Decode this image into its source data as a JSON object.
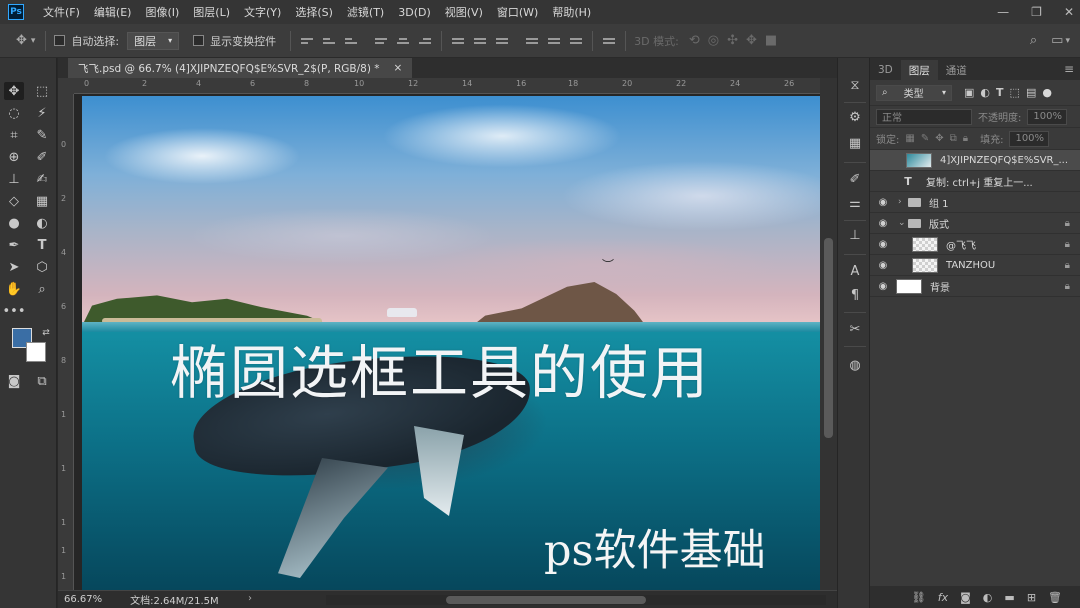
{
  "app": {
    "logo": "Ps"
  },
  "menu": [
    "文件(F)",
    "编辑(E)",
    "图像(I)",
    "图层(L)",
    "文字(Y)",
    "选择(S)",
    "滤镜(T)",
    "3D(D)",
    "视图(V)",
    "窗口(W)",
    "帮助(H)"
  ],
  "window_controls": {
    "minimize": "—",
    "restore": "❐",
    "close": "✕"
  },
  "options": {
    "auto_select_label": "自动选择:",
    "auto_select_value": "图层",
    "show_transform_label": "显示变换控件",
    "mode_3d_label": "3D 模式:"
  },
  "document": {
    "tab_title": "飞飞.psd @ 66.7% (4]XJIPNZEQFQ$E%SVR_2$(P, RGB/8) *",
    "close": "×",
    "title_text": "椭圆选框工具的使用",
    "subtitle_text": "ps软件基础"
  },
  "rulers": {
    "top": [
      "0",
      "2",
      "4",
      "6",
      "8",
      "10",
      "12",
      "14",
      "16",
      "18",
      "20",
      "22",
      "24",
      "26"
    ],
    "left": [
      "0",
      "2",
      "4",
      "6",
      "8",
      "1",
      "1",
      "1",
      "1",
      "1"
    ]
  },
  "status": {
    "zoom": "66.67%",
    "doc_info": "文档:2.64M/21.5M"
  },
  "panel": {
    "tabs": [
      "3D",
      "图层",
      "通道"
    ],
    "active_tab": "图层",
    "filter_label": "类型",
    "blend_mode": "正常",
    "opacity_label": "不透明度:",
    "opacity_value": "100%",
    "lock_label": "锁定:",
    "fill_label": "填充:",
    "fill_value": "100%"
  },
  "layers": [
    {
      "name": "4]XJIPNZEQFQ$E%SVR_...",
      "type": "smart",
      "visible": false,
      "selected": true,
      "locked": false
    },
    {
      "name": "复制: ctrl+j 重复上一...",
      "type": "text",
      "visible": false,
      "selected": false,
      "locked": false
    },
    {
      "name": "组 1",
      "type": "group",
      "visible": true,
      "selected": false,
      "locked": false
    },
    {
      "name": "版式",
      "type": "group-open",
      "visible": true,
      "selected": false,
      "locked": true
    },
    {
      "name": "@飞飞",
      "type": "pixel",
      "visible": true,
      "selected": false,
      "locked": true
    },
    {
      "name": "TANZHOU",
      "type": "pixel",
      "visible": true,
      "selected": false,
      "locked": true
    },
    {
      "name": "背景",
      "type": "background",
      "visible": true,
      "selected": false,
      "locked": true
    }
  ],
  "colors": {
    "foreground": "#3a6ea5",
    "background": "#ffffff",
    "ps_blue": "#31a8ff"
  }
}
